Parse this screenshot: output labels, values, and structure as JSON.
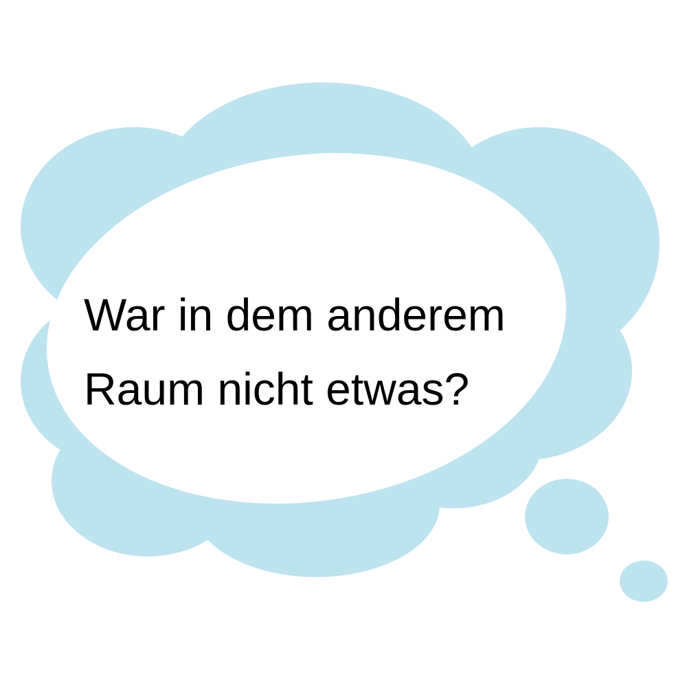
{
  "colors": {
    "background": "#ffffff",
    "cloud": "#bee3f0",
    "bubble_interior": "#ffffff",
    "text": "#000000"
  },
  "thought_bubble": {
    "lines": [
      "War in dem anderem",
      "Raum nicht etwas?"
    ]
  }
}
